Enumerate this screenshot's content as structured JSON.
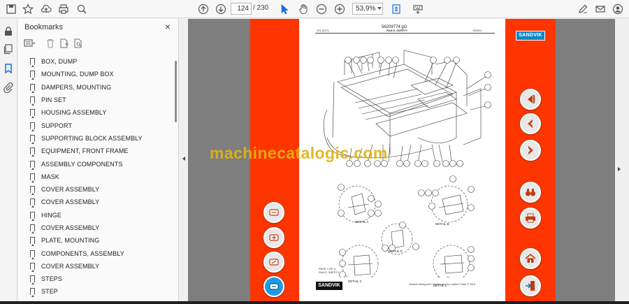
{
  "toolbar": {
    "page_current": "124",
    "page_total": "/ 230",
    "zoom": "53,9%"
  },
  "bookmarks": {
    "title": "Bookmarks",
    "close": "×",
    "items": [
      "BOX, DUMP",
      "MOUNTING, DUMP BOX",
      "DAMPERS, MOUNTING",
      "PIN SET",
      "HOUSING ASSEMBLY",
      "SUPPORT",
      "SUPPORTING BLOCK ASSEMBLY",
      "EQUIPMENT, FRONT FRAME",
      "ASSEMBLY COMPONENTS",
      "MASK",
      "COVER ASSEMBLY",
      "COVER ASSEMBLY",
      "HINGE",
      "COVER ASSEMBLY",
      "PLATE, MOUNTING",
      "COMPONENTS, ASSEMBLY",
      "COVER ASSEMBLY",
      "STEPS",
      "STEP"
    ]
  },
  "document": {
    "part_number": "56209774 gG",
    "header_left": "101 (227)",
    "header_center": "RAILS, SAFETY",
    "header_right": "100912",
    "logo": "SANDVIK",
    "footer_page": "PAGE 1 OF 4",
    "footer_title": "RAILS, SAFETY",
    "footer_copyright": "Sandvik Mining and Construction Oy Loaders Turku © 2015",
    "detail_labels": [
      "DETAIL A",
      "DETAIL B",
      "DETAIL C",
      "DETAIL D",
      "DETAIL E"
    ]
  },
  "watermark": "machinecatalogic.com",
  "colors": {
    "accent_orange": "#ff3500",
    "viewer_gray": "#7e7e7e",
    "sandvik_blue": "#0e86c9"
  }
}
